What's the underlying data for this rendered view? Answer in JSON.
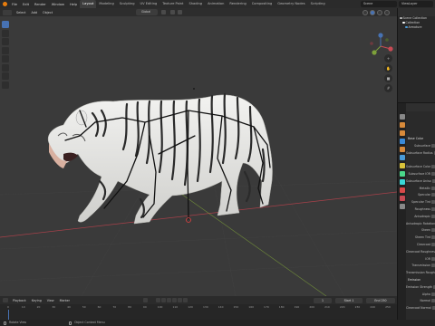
{
  "topbar": {
    "menus": [
      "File",
      "Edit",
      "Render",
      "Window",
      "Help"
    ],
    "workspaces": [
      "Layout",
      "Modeling",
      "Sculpting",
      "UV Editing",
      "Texture Paint",
      "Shading",
      "Animation",
      "Rendering",
      "Compositing",
      "Geometry Nodes",
      "Scripting"
    ],
    "active_workspace": "Layout",
    "scene": "Scene",
    "view_layer": "ViewLayer"
  },
  "viewport_header": {
    "menus": [
      "Select",
      "Add",
      "Object"
    ],
    "orientation": "Global"
  },
  "outliner": {
    "rows": [
      {
        "label": "Scene Collection",
        "icon": "collection-icon",
        "color": "#bbbbbb"
      },
      {
        "label": "Collection",
        "icon": "collection-icon",
        "color": "#ffffff"
      },
      {
        "label": "Armature",
        "icon": "armature-icon",
        "color": "#4a9bd8"
      }
    ]
  },
  "properties": {
    "rows": [
      {
        "label": "Base Color",
        "section": true
      },
      {
        "label": "Subsurface",
        "section": false
      },
      {
        "label": "Subsurface Radius",
        "section": false
      },
      {
        "label": "",
        "section": false
      },
      {
        "label": "Subsurface Color",
        "section": false
      },
      {
        "label": "Subsurface IOR",
        "section": false
      },
      {
        "label": "Subsurface Aniso",
        "section": false
      },
      {
        "label": "Metallic",
        "section": false
      },
      {
        "label": "Specular",
        "section": false
      },
      {
        "label": "Specular Tint",
        "section": false
      },
      {
        "label": "Roughness",
        "section": false
      },
      {
        "label": "Anisotropic",
        "section": false
      },
      {
        "label": "Anisotropic Rotation",
        "section": false
      },
      {
        "label": "Sheen",
        "section": false
      },
      {
        "label": "Sheen Tint",
        "section": false
      },
      {
        "label": "Clearcoat",
        "section": false
      },
      {
        "label": "Clearcoat Roughness",
        "section": false
      },
      {
        "label": "IOR",
        "section": false
      },
      {
        "label": "Transmission",
        "section": false
      },
      {
        "label": "Transmission Roughness",
        "section": false
      },
      {
        "label": "Emission",
        "section": true
      },
      {
        "label": "Emission Strength",
        "section": false
      },
      {
        "label": "Alpha",
        "section": false
      },
      {
        "label": "Normal",
        "section": false
      },
      {
        "label": "Clearcoat Normal",
        "section": false
      }
    ]
  },
  "timeline": {
    "menus": [
      "Playback",
      "Keying",
      "View",
      "Marker"
    ],
    "current_frame": "1",
    "start_label": "Start",
    "start": "1",
    "end_label": "End",
    "end": "250",
    "ticks": [
      "0",
      "10",
      "20",
      "30",
      "40",
      "50",
      "60",
      "70",
      "80",
      "90",
      "100",
      "110",
      "120",
      "130",
      "140",
      "150",
      "160",
      "170",
      "180",
      "190",
      "200",
      "210",
      "220",
      "230",
      "240",
      "250"
    ]
  },
  "statusbar": {
    "rotate": "Rotate View",
    "context": "Object Context Menu"
  },
  "colors": {
    "accent": "#4772b3",
    "viewport_bg": "#3a3a3a",
    "x_axis": "#a8414a",
    "y_axis": "#7da03a"
  }
}
